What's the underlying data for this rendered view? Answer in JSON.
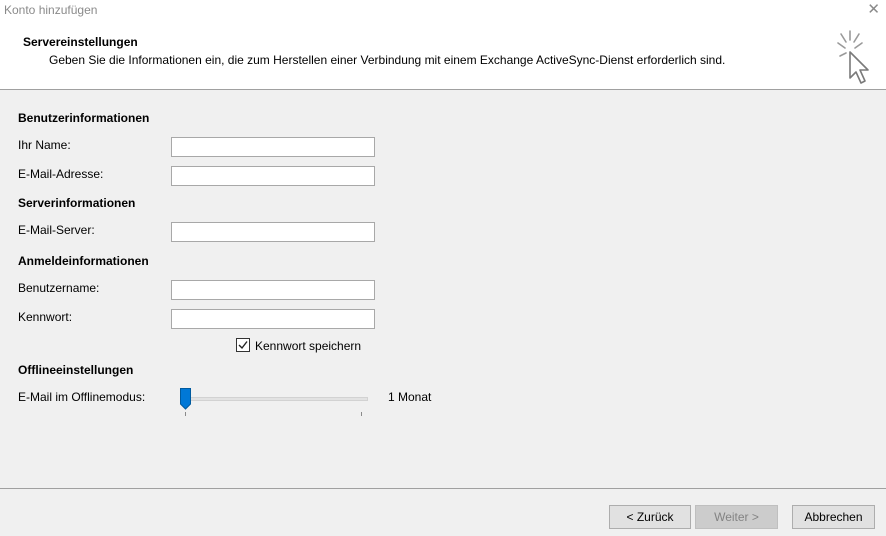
{
  "window": {
    "title": "Konto hinzufügen",
    "close_glyph": "✕"
  },
  "header": {
    "title": "Servereinstellungen",
    "description": "Geben Sie die Informationen ein, die zum Herstellen einer Verbindung mit einem Exchange ActiveSync-Dienst erforderlich sind.",
    "icon": "wizard-cursor-icon"
  },
  "sections": {
    "user": "Benutzerinformationen",
    "server": "Serverinformationen",
    "login": "Anmeldeinformationen",
    "offline": "Offlineeinstellungen"
  },
  "fields": {
    "name_label": "Ihr Name:",
    "name_value": "",
    "email_label": "E-Mail-Adresse:",
    "email_value": "",
    "server_label": "E-Mail-Server:",
    "server_value": "",
    "username_label": "Benutzername:",
    "username_value": "",
    "password_label": "Kennwort:",
    "password_value": ""
  },
  "remember_password": {
    "label": "Kennwort speichern",
    "checked": true
  },
  "offline_mode": {
    "label": "E-Mail im Offlinemodus:",
    "value_text": "1 Monat",
    "position": 0
  },
  "buttons": {
    "back": "< Zurück",
    "next": "Weiter >",
    "cancel": "Abbrechen"
  },
  "colors": {
    "accent": "#0078d7",
    "border": "#a0a0a0"
  }
}
